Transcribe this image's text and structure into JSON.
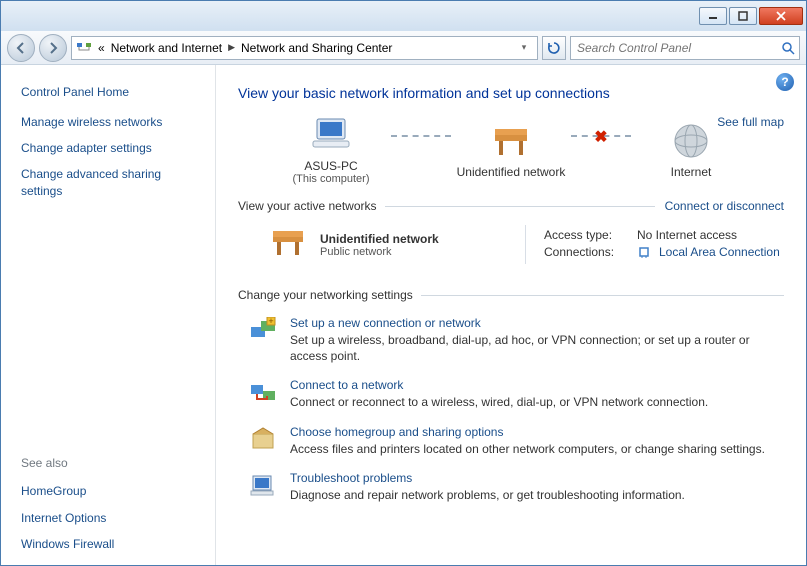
{
  "breadcrumb": {
    "prefix": "«",
    "parent": "Network and Internet",
    "current": "Network and Sharing Center"
  },
  "search": {
    "placeholder": "Search Control Panel"
  },
  "sidebar": {
    "home": "Control Panel Home",
    "links": [
      "Manage wireless networks",
      "Change adapter settings",
      "Change advanced sharing settings"
    ],
    "seealso_title": "See also",
    "seealso": [
      "HomeGroup",
      "Internet Options",
      "Windows Firewall"
    ]
  },
  "main": {
    "title": "View your basic network information and set up connections",
    "map_link": "See full map",
    "nodes": {
      "pc_name": "ASUS-PC",
      "pc_sub": "(This computer)",
      "net_name": "Unidentified network",
      "internet": "Internet"
    },
    "active_head": "View your active networks",
    "active_link": "Connect or disconnect",
    "active": {
      "name": "Unidentified network",
      "type": "Public network",
      "access_label": "Access type:",
      "access_value": "No Internet access",
      "conn_label": "Connections:",
      "conn_value": "Local Area Connection"
    },
    "change_head": "Change your networking settings",
    "tasks": [
      {
        "title": "Set up a new connection or network",
        "desc": "Set up a wireless, broadband, dial-up, ad hoc, or VPN connection; or set up a router or access point."
      },
      {
        "title": "Connect to a network",
        "desc": "Connect or reconnect to a wireless, wired, dial-up, or VPN network connection."
      },
      {
        "title": "Choose homegroup and sharing options",
        "desc": "Access files and printers located on other network computers, or change sharing settings."
      },
      {
        "title": "Troubleshoot problems",
        "desc": "Diagnose and repair network problems, or get troubleshooting information."
      }
    ]
  }
}
